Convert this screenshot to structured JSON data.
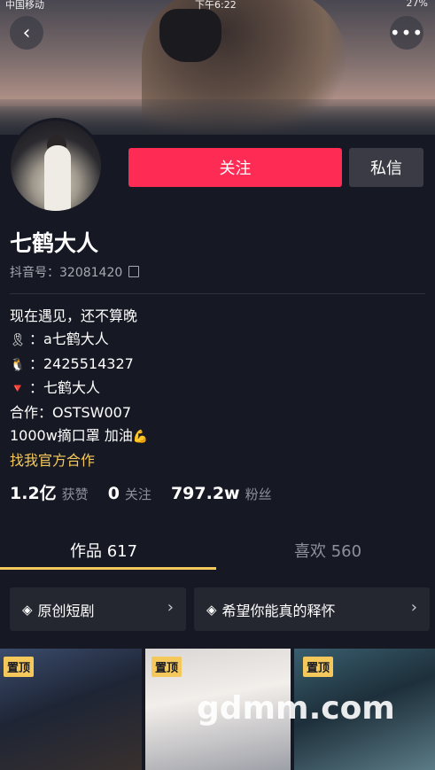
{
  "status_bar": {
    "carrier": "中国移动",
    "time": "下午6:22",
    "battery": "27%"
  },
  "banner": {},
  "profile": {
    "nickname": "七鹤大人",
    "uid_label": "抖音号：32081420",
    "bio_lines": [
      {
        "icon": "ribbon-icon",
        "text": "现在遇见，还不算晚"
      },
      {
        "icon": "ribbon-icon",
        "text": "：a七鹤大人"
      },
      {
        "icon": "penguin-icon",
        "text": "：2425514327"
      },
      {
        "icon": "weibo-icon",
        "text": "：七鹤大人"
      },
      {
        "icon": "",
        "text": "合作：OSTSW007"
      },
      {
        "icon": "muscle-icon",
        "text": "1000w摘口罩 加油"
      }
    ],
    "official_link": "找我官方合作"
  },
  "actions": {
    "follow_label": "关注",
    "message_label": "私信"
  },
  "stats": {
    "likes_num": "1.2亿",
    "likes_label": "获赞",
    "following_num": "0",
    "following_label": "关注",
    "followers_num": "797.2w",
    "followers_label": "粉丝"
  },
  "tabs": {
    "works": "作品 617",
    "likes": "喜欢 560"
  },
  "collections": {
    "c1": "原创短剧",
    "c2": "希望你能真的释怀"
  },
  "pinned_label": "置顶",
  "watermark": "gdmm.com",
  "colors": {
    "accent_red": "#fe2c55",
    "accent_gold": "#f5c85b",
    "bg": "#161823"
  }
}
